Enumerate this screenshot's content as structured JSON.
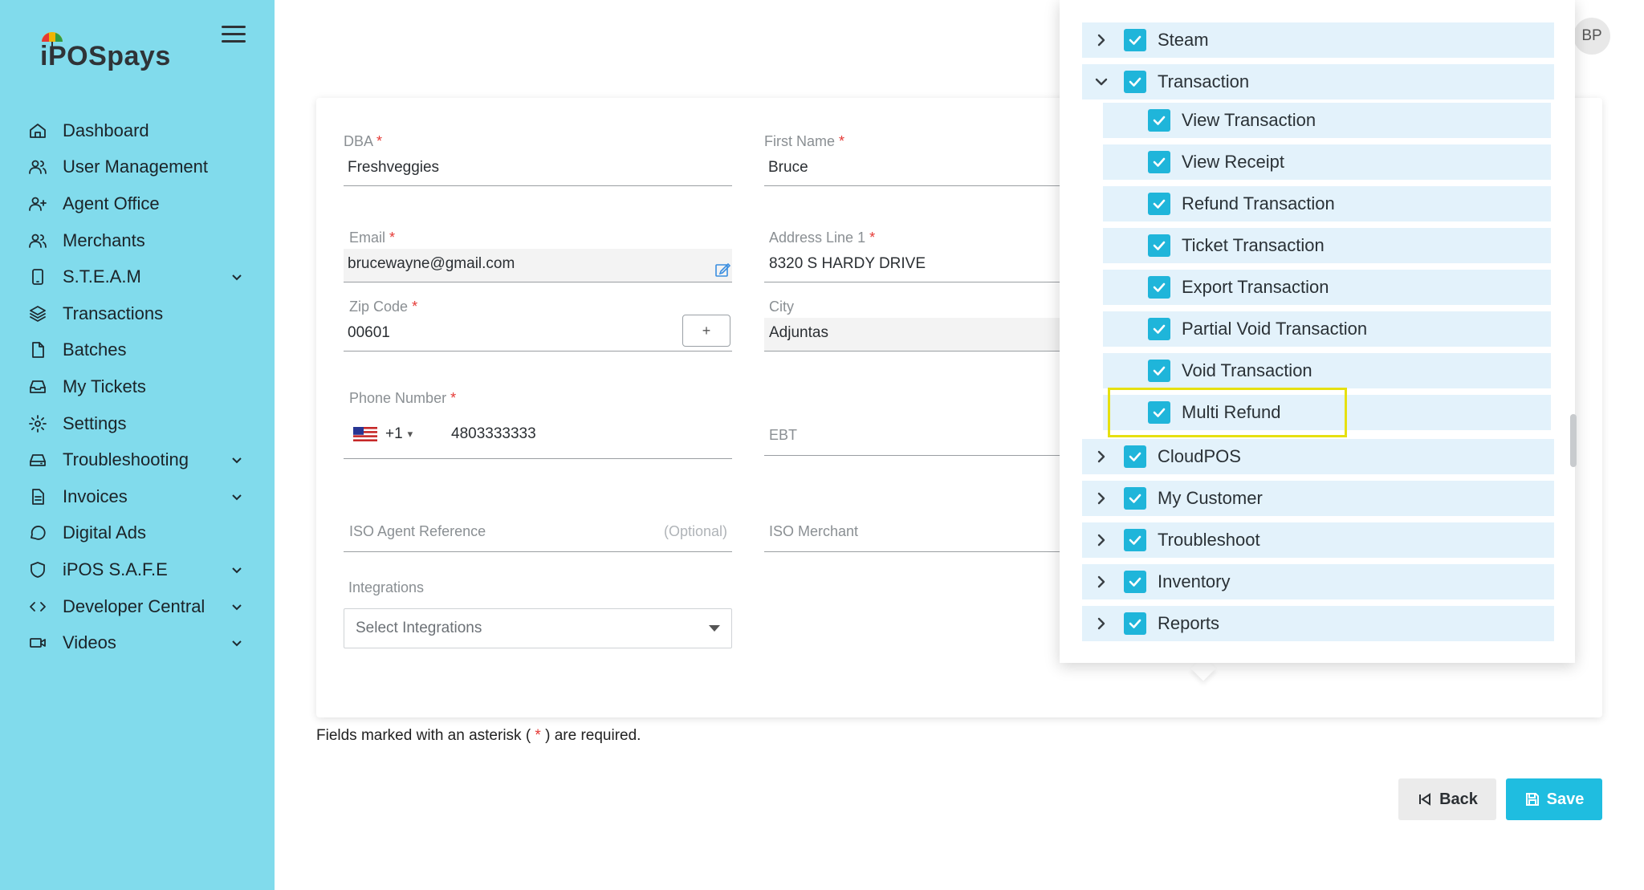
{
  "brand": {
    "logo_text": "iPOSpays"
  },
  "sidebar": {
    "items": [
      {
        "label": "Dashboard",
        "icon": "home-icon",
        "has_submenu": false
      },
      {
        "label": "User Management",
        "icon": "users-icon",
        "has_submenu": false
      },
      {
        "label": "Agent Office",
        "icon": "user-plus-icon",
        "has_submenu": false
      },
      {
        "label": "Merchants",
        "icon": "users-icon",
        "has_submenu": false
      },
      {
        "label": "S.T.E.A.M",
        "icon": "tablet-icon",
        "has_submenu": true
      },
      {
        "label": "Transactions",
        "icon": "layers-icon",
        "has_submenu": false
      },
      {
        "label": "Batches",
        "icon": "file-icon",
        "has_submenu": false
      },
      {
        "label": "My Tickets",
        "icon": "inbox-icon",
        "has_submenu": false
      },
      {
        "label": "Settings",
        "icon": "gear-icon",
        "has_submenu": false
      },
      {
        "label": "Troubleshooting",
        "icon": "drive-icon",
        "has_submenu": true
      },
      {
        "label": "Invoices",
        "icon": "file-text-icon",
        "has_submenu": true
      },
      {
        "label": "Digital Ads",
        "icon": "chat-icon",
        "has_submenu": false
      },
      {
        "label": "iPOS S.A.F.E",
        "icon": "shield-icon",
        "has_submenu": true
      },
      {
        "label": "Developer Central",
        "icon": "code-icon",
        "has_submenu": true
      },
      {
        "label": "Videos",
        "icon": "video-icon",
        "has_submenu": true
      }
    ]
  },
  "user": {
    "initials": "BP"
  },
  "form": {
    "dba": {
      "label": "DBA",
      "required_mark": "*",
      "value": "Freshveggies"
    },
    "first_name": {
      "label": "First Name",
      "required_mark": "*",
      "value": "Bruce"
    },
    "email": {
      "label": "Email",
      "required_mark": "*",
      "value": "brucewayne@gmail.com"
    },
    "address_line1": {
      "label": "Address Line 1",
      "required_mark": "*",
      "value": "8320 S HARDY DRIVE"
    },
    "zip_code": {
      "label": "Zip Code",
      "required_mark": "*",
      "value": "00601",
      "button_label": "+"
    },
    "city": {
      "label": "City",
      "value": "Adjuntas"
    },
    "phone": {
      "label": "Phone Number",
      "required_mark": "*",
      "country_code": "+1",
      "caret": "▾",
      "value": "4803333333"
    },
    "ebt": {
      "placeholder": "EBT"
    },
    "iso_agent_reference": {
      "placeholder": "ISO Agent Reference",
      "hint": "(Optional)"
    },
    "iso_merchant": {
      "placeholder": "ISO Merchant"
    },
    "integrations": {
      "label": "Integrations",
      "placeholder": "Select Integrations"
    }
  },
  "footnote": {
    "before": "Fields marked with an asterisk ( ",
    "star": "*",
    "after": " ) are required."
  },
  "buttons": {
    "back": "Back",
    "save": "Save"
  },
  "permissions": {
    "groups_top": [
      {
        "label": "Steam",
        "checked": true,
        "expanded": false
      },
      {
        "label": "Transaction",
        "checked": true,
        "expanded": true
      }
    ],
    "transaction_children": [
      {
        "label": "View Transaction",
        "checked": true
      },
      {
        "label": "View Receipt",
        "checked": true
      },
      {
        "label": "Refund Transaction",
        "checked": true
      },
      {
        "label": "Ticket Transaction",
        "checked": true
      },
      {
        "label": "Export Transaction",
        "checked": true
      },
      {
        "label": "Partial Void Transaction",
        "checked": true
      },
      {
        "label": "Void Transaction",
        "checked": true
      },
      {
        "label": "Multi Refund",
        "checked": true,
        "highlighted": true
      }
    ],
    "groups_bottom": [
      {
        "label": "CloudPOS",
        "checked": true,
        "expanded": false
      },
      {
        "label": "My Customer",
        "checked": true,
        "expanded": false
      },
      {
        "label": "Troubleshoot",
        "checked": true,
        "expanded": false
      },
      {
        "label": "Inventory",
        "checked": true,
        "expanded": false
      },
      {
        "label": "Reports",
        "checked": true,
        "expanded": false
      }
    ]
  },
  "colors": {
    "sidebar": "#81dbec",
    "accent": "#1fb5da",
    "save_button": "#1fbde0",
    "row_bg": "#e3f2fb",
    "highlight": "#e6e010",
    "required": "#e53935"
  }
}
